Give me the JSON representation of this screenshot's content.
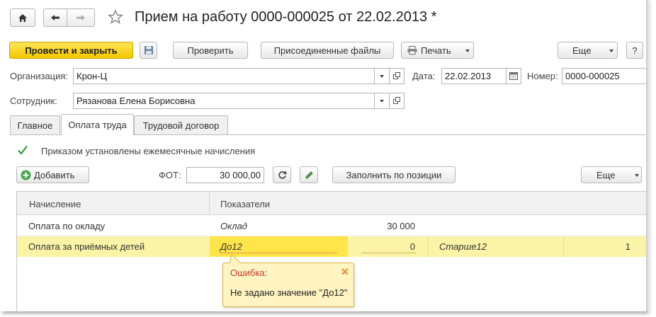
{
  "window": {
    "title": "Прием на работу 0000-000025 от 22.02.2013 *"
  },
  "toolbar": {
    "post_close_label": "Провести и закрыть",
    "check_label": "Проверить",
    "files_label": "Присоединенные файлы",
    "print_label": "Печать",
    "more_label": "Еще",
    "help_label": "?"
  },
  "form": {
    "org_label": "Организация:",
    "org_value": "Крон-Ц",
    "date_label": "Дата:",
    "date_value": "22.02.2013",
    "number_label": "Номер:",
    "number_value": "0000-000025",
    "employee_label": "Сотрудник:",
    "employee_value": "Рязанова Елена Борисовна"
  },
  "tabs": [
    {
      "label": "Главное"
    },
    {
      "label": "Оплата труда"
    },
    {
      "label": "Трудовой договор"
    }
  ],
  "pay": {
    "checkbox_label": "Приказом установлены ежемесячные начисления",
    "checkbox_checked": true,
    "add_label": "Добавить",
    "fot_label": "ФОТ:",
    "fot_value": "30 000,00",
    "fill_label": "Заполнить по позиции",
    "more_label": "Еще"
  },
  "table": {
    "columns": [
      "Начисление",
      "Показатели"
    ],
    "rows": [
      {
        "accrual": "Оплата по окладу",
        "indicator": "Оклад",
        "value": "30 000",
        "indicator2": "",
        "value2": ""
      },
      {
        "accrual": "Оплата за приёмных детей",
        "indicator": "До12",
        "value": "0",
        "indicator2": "Старше12",
        "value2": "1"
      }
    ]
  },
  "error": {
    "title": "Ошибка:",
    "message": "Не задано значение \"До12\""
  },
  "colors": {
    "accent_yellow": "#f5c800",
    "selected_row": "#fbf3a6",
    "active_cell": "#ffe44a",
    "error_bg": "#fff4c2",
    "error_title": "#c0392b"
  }
}
